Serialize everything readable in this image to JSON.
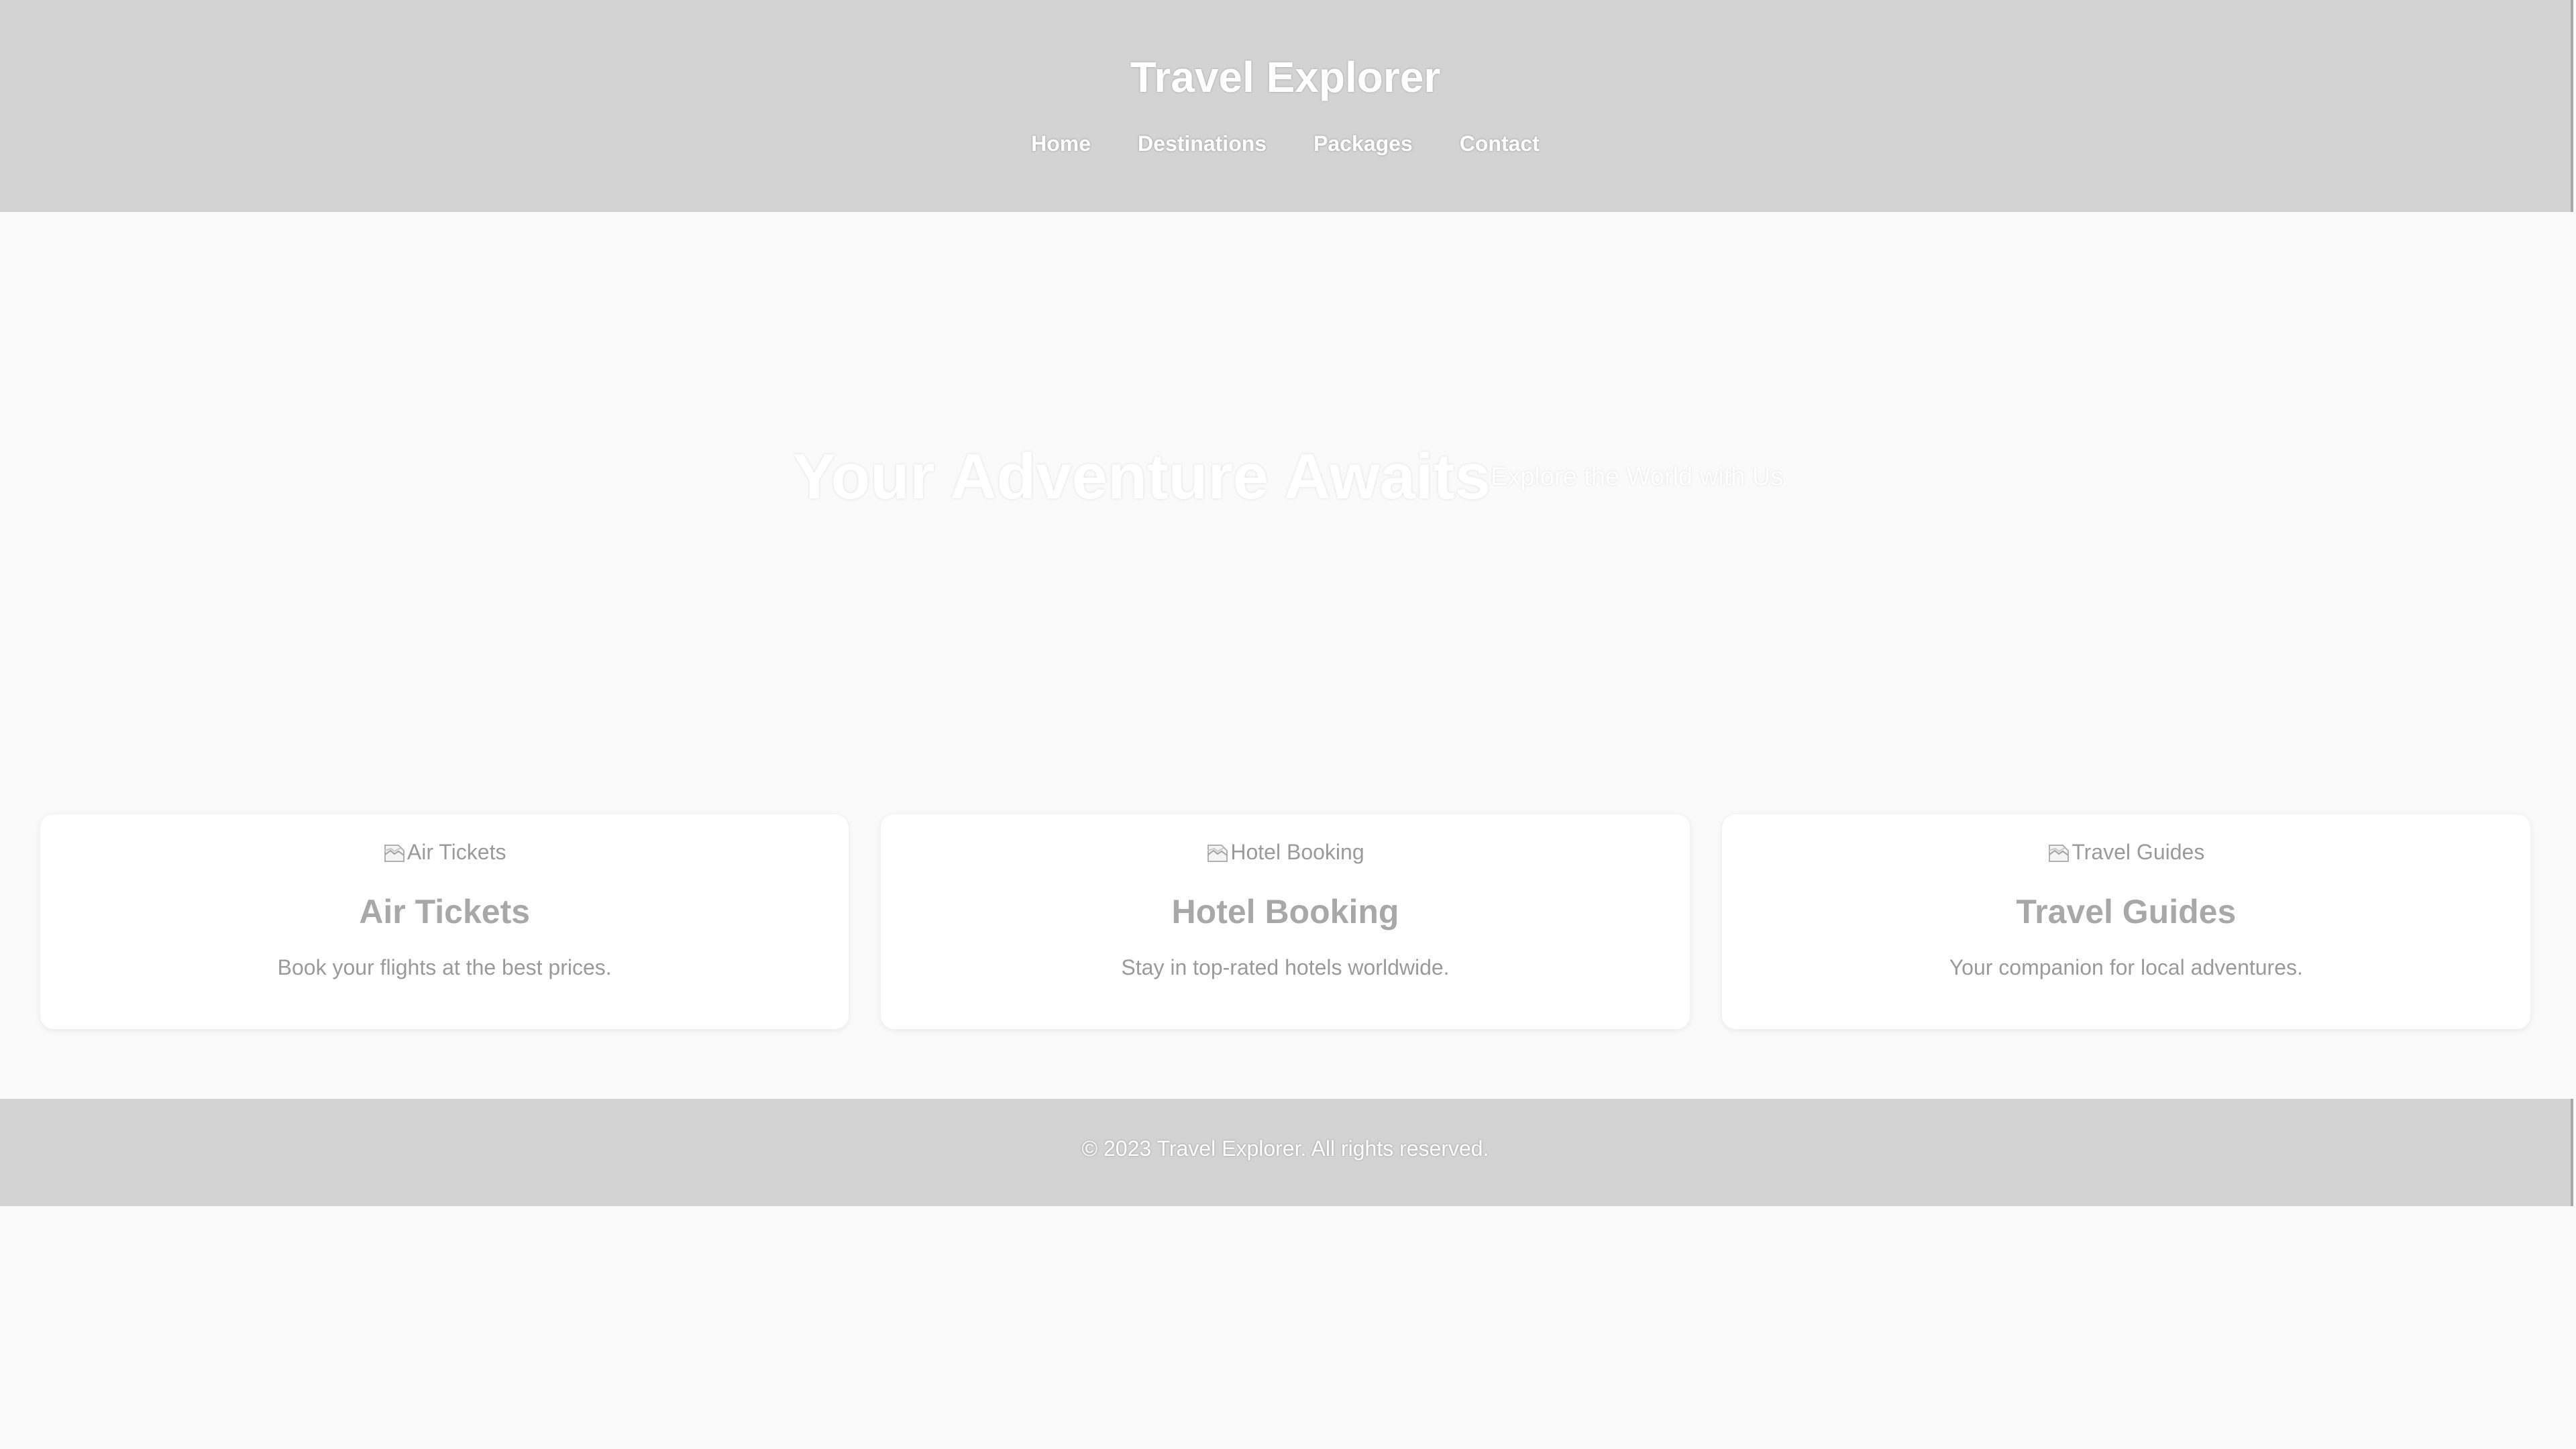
{
  "header": {
    "title": "Travel Explorer",
    "nav": [
      {
        "label": "Home"
      },
      {
        "label": "Destinations"
      },
      {
        "label": "Packages"
      },
      {
        "label": "Contact"
      }
    ]
  },
  "hero": {
    "title": "Your Adventure Awaits",
    "subtitle": "Explore the World with Us"
  },
  "cards": [
    {
      "image_alt": "Air Tickets",
      "title": "Air Tickets",
      "description": "Book your flights at the best prices.",
      "icon": "broken-image-icon"
    },
    {
      "image_alt": "Hotel Booking",
      "title": "Hotel Booking",
      "description": "Stay in top-rated hotels worldwide.",
      "icon": "broken-image-icon"
    },
    {
      "image_alt": "Travel Guides",
      "title": "Travel Guides",
      "description": "Your companion for local adventures.",
      "icon": "broken-image-icon"
    }
  ],
  "footer": {
    "text": "© 2023 Travel Explorer. All rights reserved."
  },
  "colors": {
    "header_bg": "#d3d3d3",
    "page_bg": "#fafafa",
    "card_title": "#a8a8a8",
    "card_text": "#9a9a9a"
  }
}
